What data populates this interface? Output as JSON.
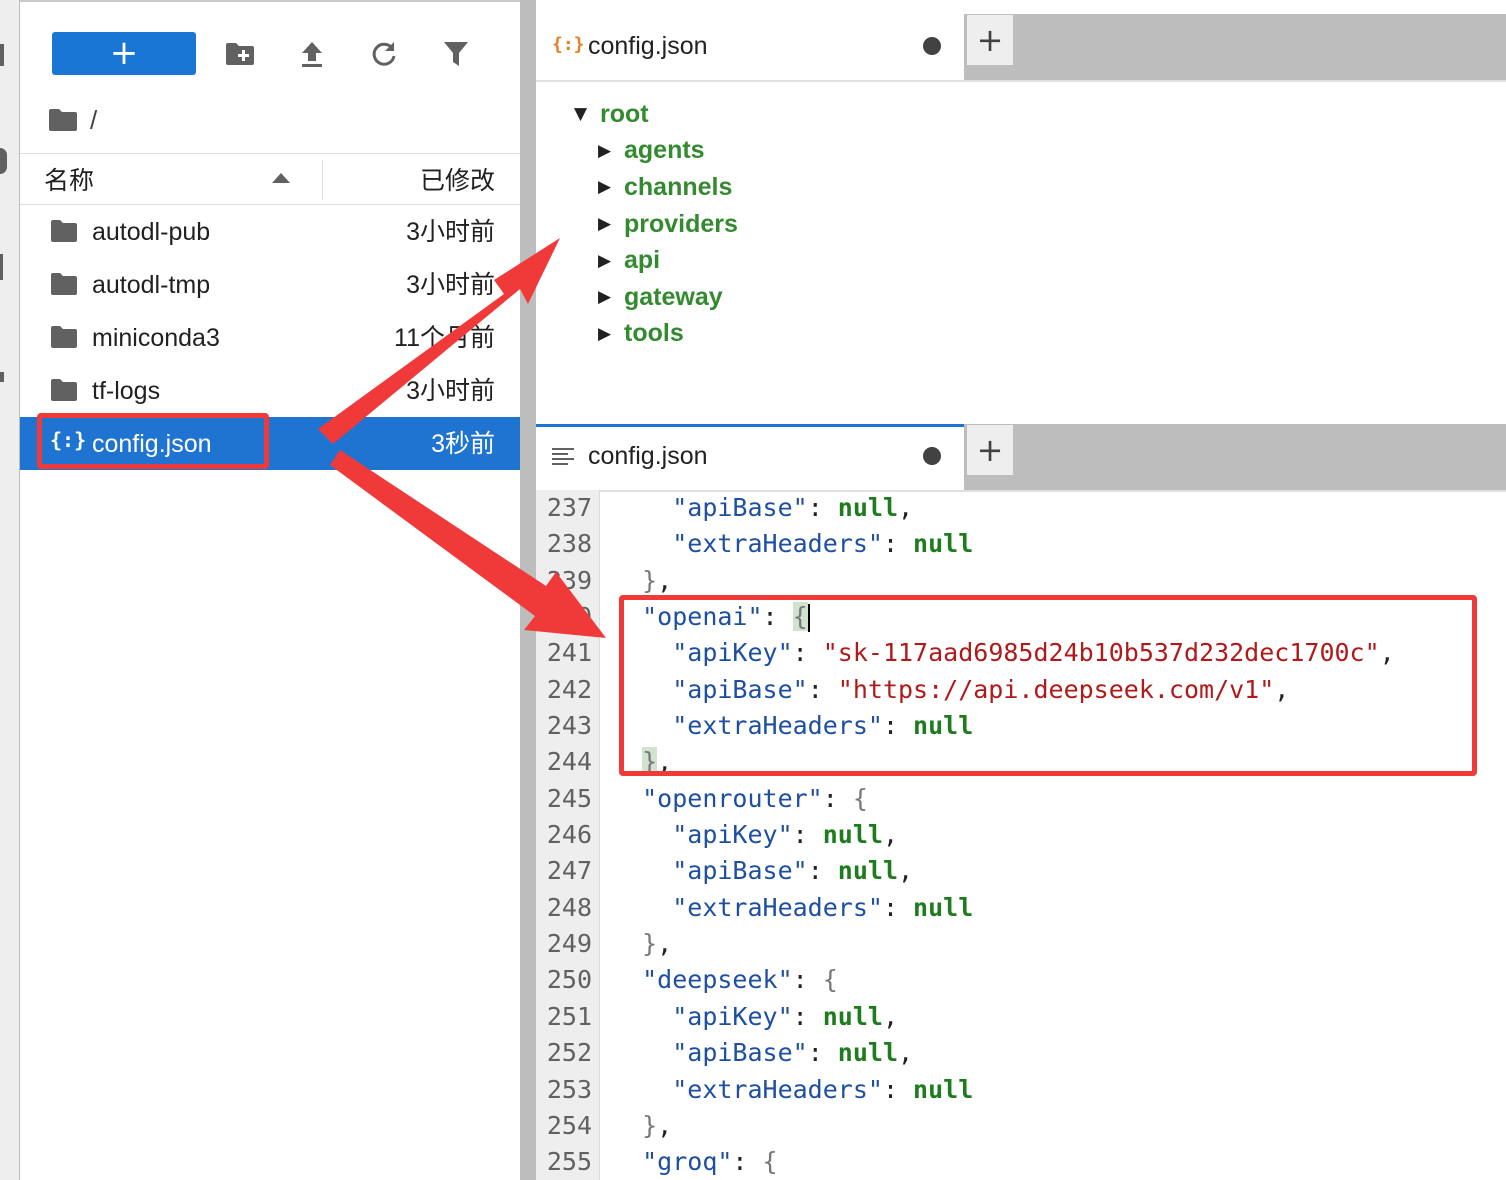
{
  "toolbar": {
    "new_label": "+",
    "icons": [
      "new-folder-icon",
      "upload-icon",
      "refresh-icon",
      "filter-icon"
    ]
  },
  "breadcrumb": {
    "path": "/"
  },
  "file_list": {
    "col_name": "名称",
    "col_modified": "已修改",
    "files": [
      {
        "name": "autodl-pub",
        "modified": "3小时前",
        "type": "folder"
      },
      {
        "name": "autodl-tmp",
        "modified": "3小时前",
        "type": "folder"
      },
      {
        "name": "miniconda3",
        "modified": "11个月前",
        "type": "folder"
      },
      {
        "name": "tf-logs",
        "modified": "3小时前",
        "type": "folder"
      },
      {
        "name": "config.json",
        "modified": "3秒前",
        "type": "json",
        "selected": true
      }
    ]
  },
  "tree_pane": {
    "tab_label": "config.json",
    "add_tab": "+",
    "root": "root",
    "children": [
      "agents",
      "channels",
      "providers",
      "api",
      "gateway",
      "tools"
    ]
  },
  "code_pane": {
    "tab_label": "config.json",
    "add_tab": "+",
    "line_numbers": [
      "237",
      "238",
      "239",
      "240",
      "241",
      "242",
      "243",
      "244",
      "245",
      "246",
      "247",
      "248",
      "249",
      "250",
      "251",
      "252",
      "253",
      "254",
      "255"
    ]
  },
  "colors": {
    "accent": "#1976d2",
    "selected_row": "#1e74d0",
    "tree_key": "#338a2f",
    "annotation": "#f03a3a"
  }
}
